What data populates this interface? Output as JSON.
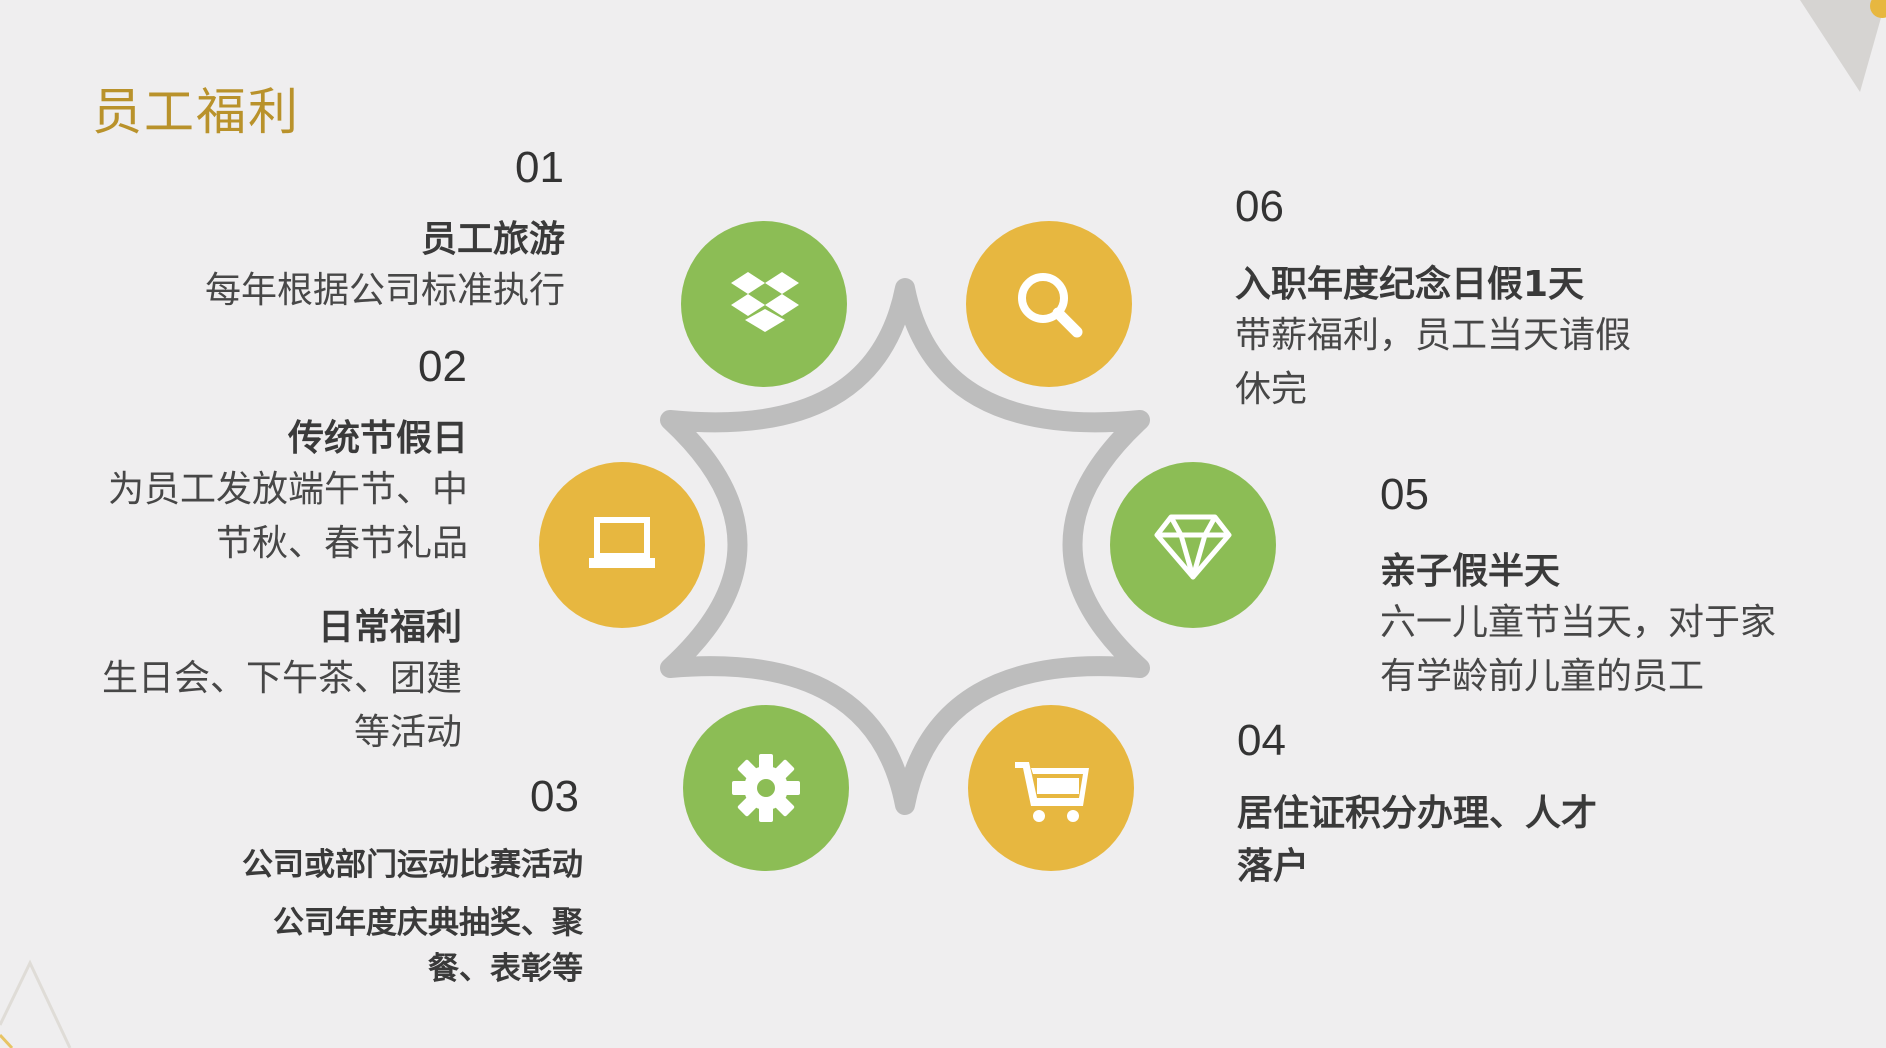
{
  "title": "员工福利",
  "colors": {
    "green": "#8cbd55",
    "yellow": "#e7b740",
    "ring": "#bdbdbd",
    "title": "#b9922b"
  },
  "items": [
    {
      "num": "01",
      "heading": "员工旅游",
      "desc": "每年根据公司标准执行",
      "icon": "dropbox-icon",
      "color": "green"
    },
    {
      "num": "02",
      "heading": "传统节假日",
      "desc_lines": [
        "为员工发放端午节、中",
        "节秋、春节礼品"
      ],
      "heading2": "日常福利",
      "desc2_lines": [
        "生日会、下午茶、团建",
        "等活动"
      ],
      "icon": "laptop-icon",
      "color": "yellow"
    },
    {
      "num": "03",
      "lines": [
        "公司或部门运动比赛活动",
        "公司年度庆典抽奖、聚",
        "餐、表彰等"
      ],
      "icon": "gear-icon",
      "color": "green"
    },
    {
      "num": "04",
      "lines": [
        "居住证积分办理、人才",
        "落户"
      ],
      "icon": "cart-icon",
      "color": "yellow"
    },
    {
      "num": "05",
      "heading": "亲子假半天",
      "desc_lines": [
        "六一儿童节当天，对于家",
        "有学龄前儿童的员工"
      ],
      "icon": "diamond-icon",
      "color": "green"
    },
    {
      "num": "06",
      "heading": "入职年度纪念日假1天",
      "desc_lines": [
        "带薪福利，员工当天请假",
        "休完"
      ],
      "icon": "search-icon",
      "color": "yellow"
    }
  ]
}
